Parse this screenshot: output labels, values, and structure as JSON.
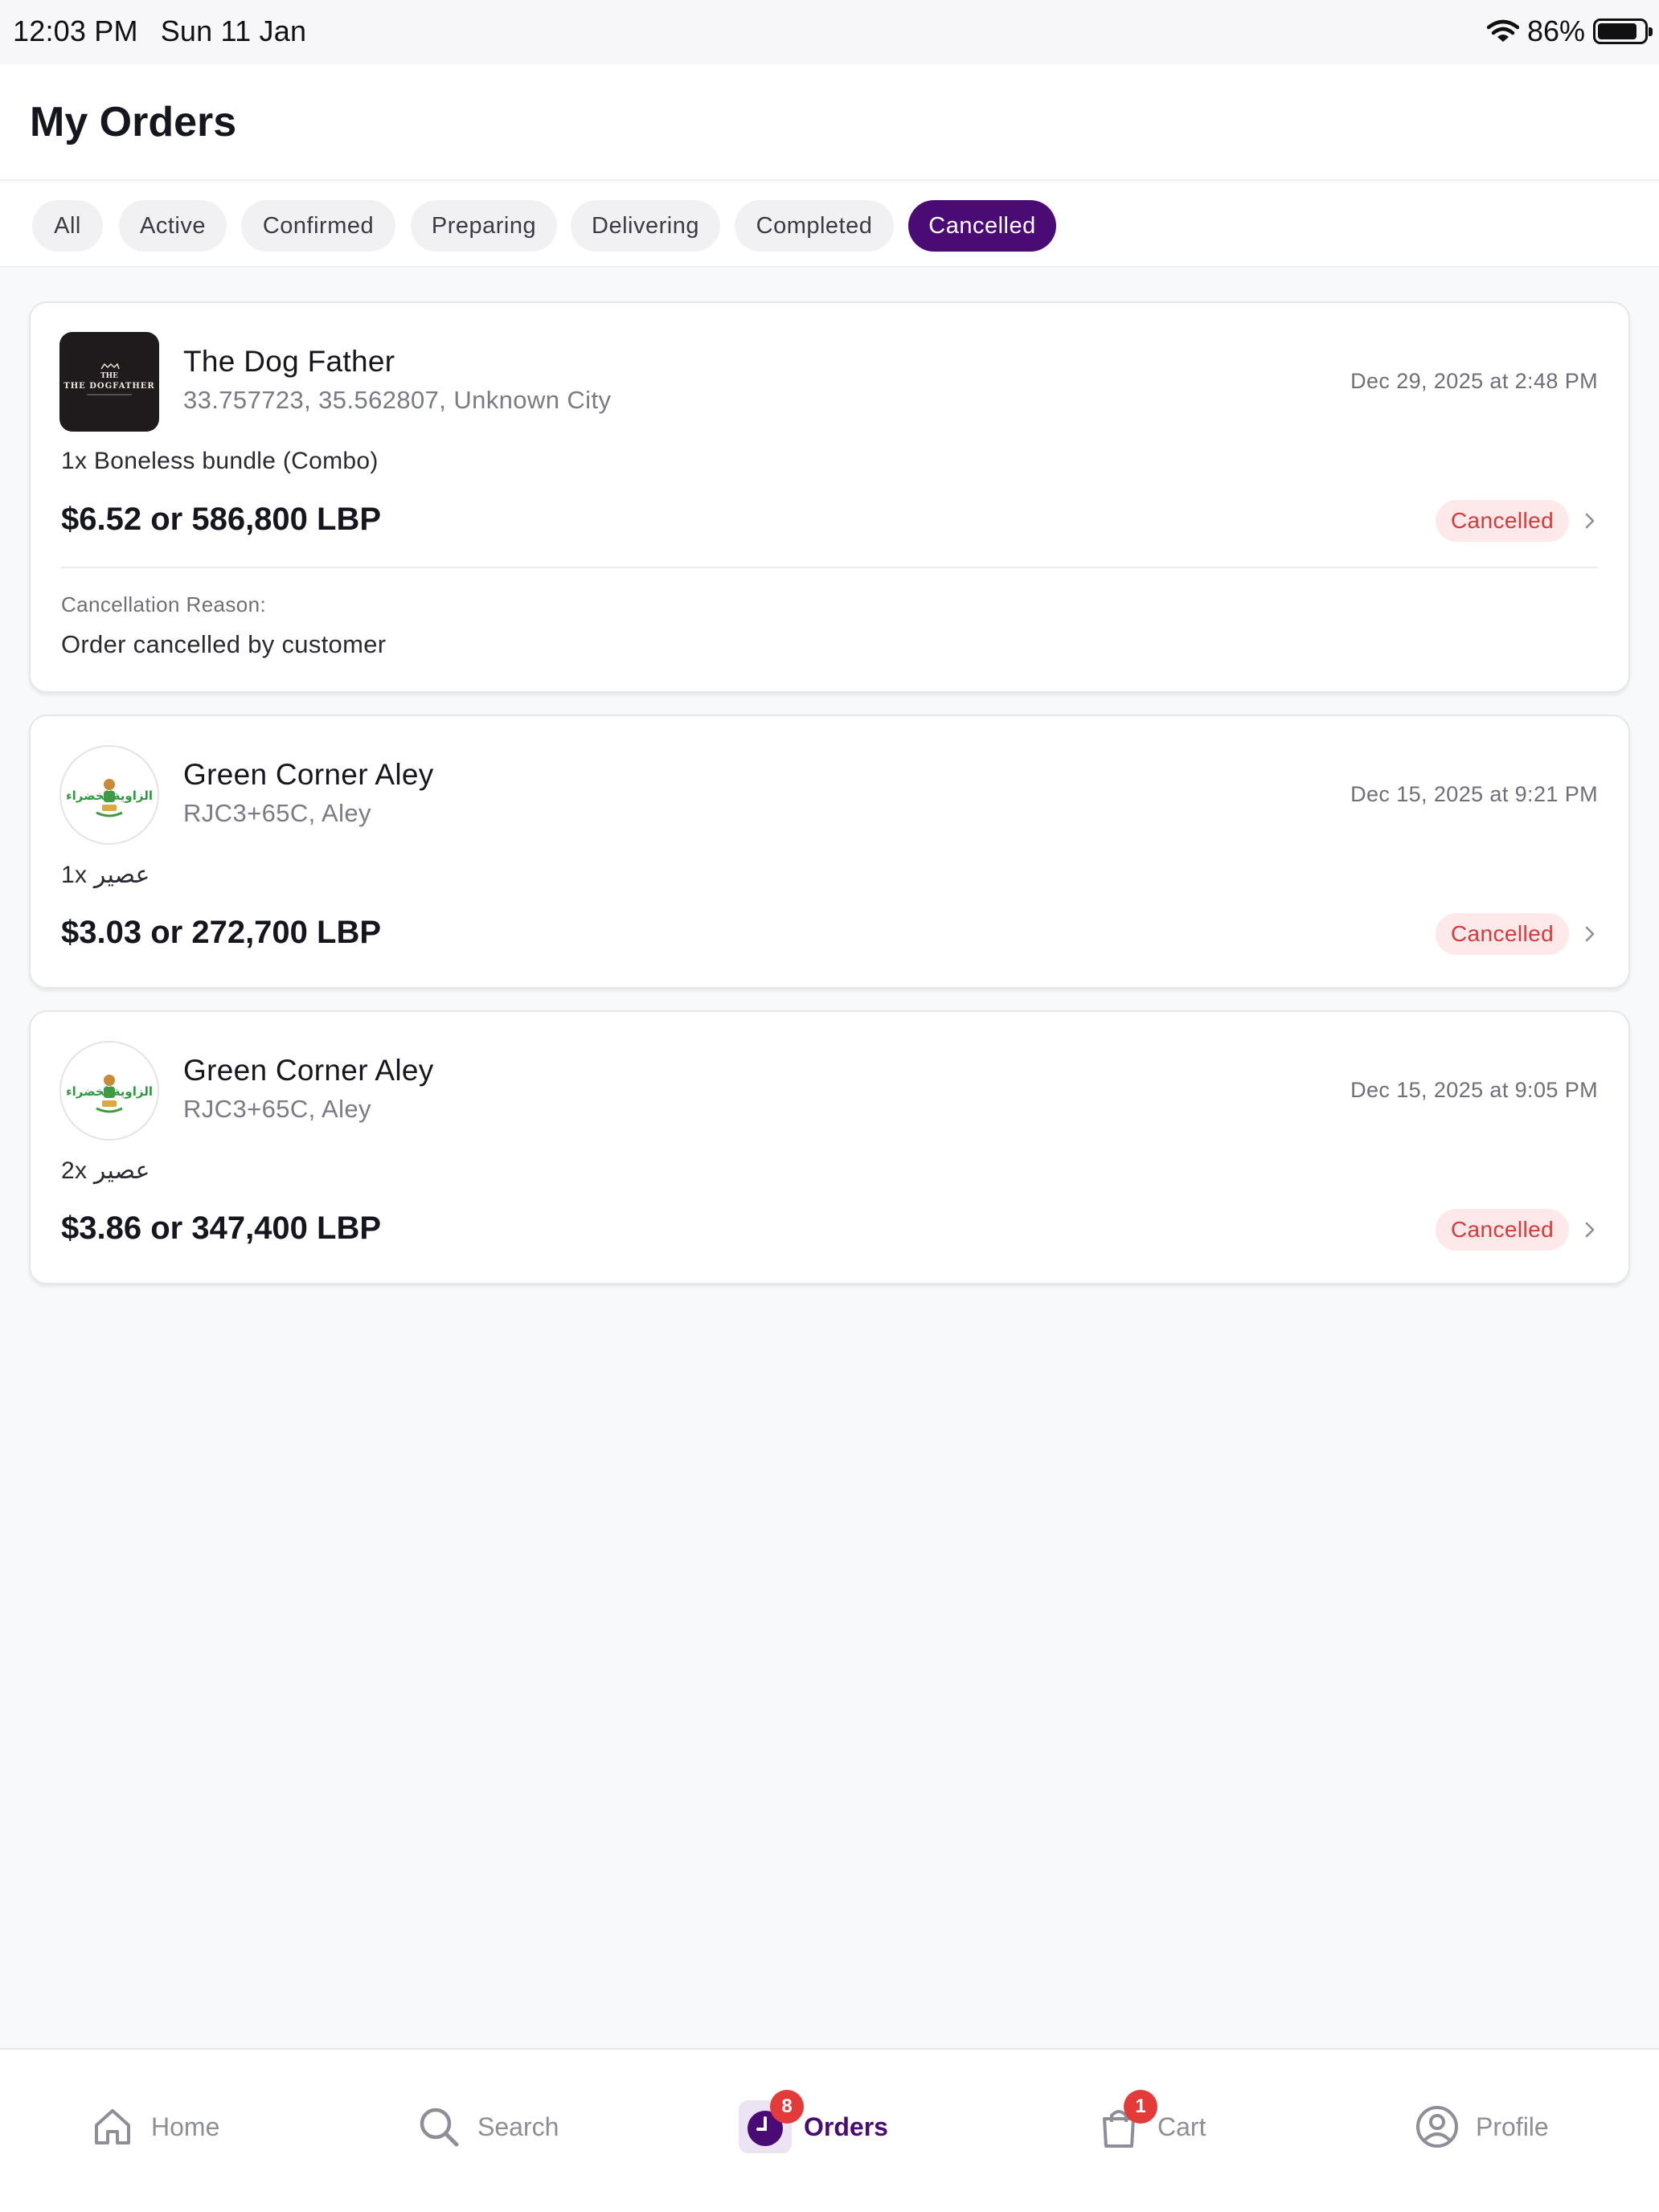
{
  "status_bar": {
    "time": "12:03 PM",
    "date": "Sun 11 Jan",
    "battery": "86%",
    "wifi_icon": "wifi-icon",
    "battery_icon": "battery-icon"
  },
  "header": {
    "title": "My Orders"
  },
  "tabs": [
    {
      "label": "All"
    },
    {
      "label": "Active"
    },
    {
      "label": "Confirmed"
    },
    {
      "label": "Preparing"
    },
    {
      "label": "Delivering"
    },
    {
      "label": "Completed"
    },
    {
      "label": "Cancelled",
      "active": true
    }
  ],
  "orders": [
    {
      "restaurant": "The Dog Father",
      "logo_text": "THE DOGFATHER",
      "address": "33.757723, 35.562807, Unknown City",
      "date": "Dec 29, 2025 at 2:48 PM",
      "items": "1x Boneless bundle (Combo)",
      "price": "$6.52 or 586,800 LBP",
      "status": "Cancelled",
      "reason_label": "Cancellation Reason:",
      "reason": "Order cancelled by customer"
    },
    {
      "restaurant": "Green Corner Aley",
      "logo_text_ar_right": "الزاوية",
      "logo_text_ar_left": "الخضراء",
      "address": "RJC3+65C, Aley",
      "date": "Dec 15, 2025 at 9:21 PM",
      "items": "1x عصير",
      "price": "$3.03 or 272,700 LBP",
      "status": "Cancelled"
    },
    {
      "restaurant": "Green Corner Aley",
      "logo_text_ar_right": "الزاوية",
      "logo_text_ar_left": "الخضراء",
      "address": "RJC3+65C, Aley",
      "date": "Dec 15, 2025 at 9:05 PM",
      "items": "2x عصير",
      "price": "$3.86 or 347,400 LBP",
      "status": "Cancelled"
    }
  ],
  "bottom_nav": [
    {
      "label": "Home",
      "icon": "home-icon"
    },
    {
      "label": "Search",
      "icon": "search-icon"
    },
    {
      "label": "Orders",
      "icon": "orders-icon",
      "badge": "8",
      "active": true
    },
    {
      "label": "Cart",
      "icon": "cart-icon",
      "badge": "1"
    },
    {
      "label": "Profile",
      "icon": "profile-icon"
    }
  ],
  "colors": {
    "accent": "#4a0b75",
    "cancelled_text": "#d63a3a",
    "cancelled_bg": "#fde9e9",
    "badge": "#e53a3a"
  }
}
